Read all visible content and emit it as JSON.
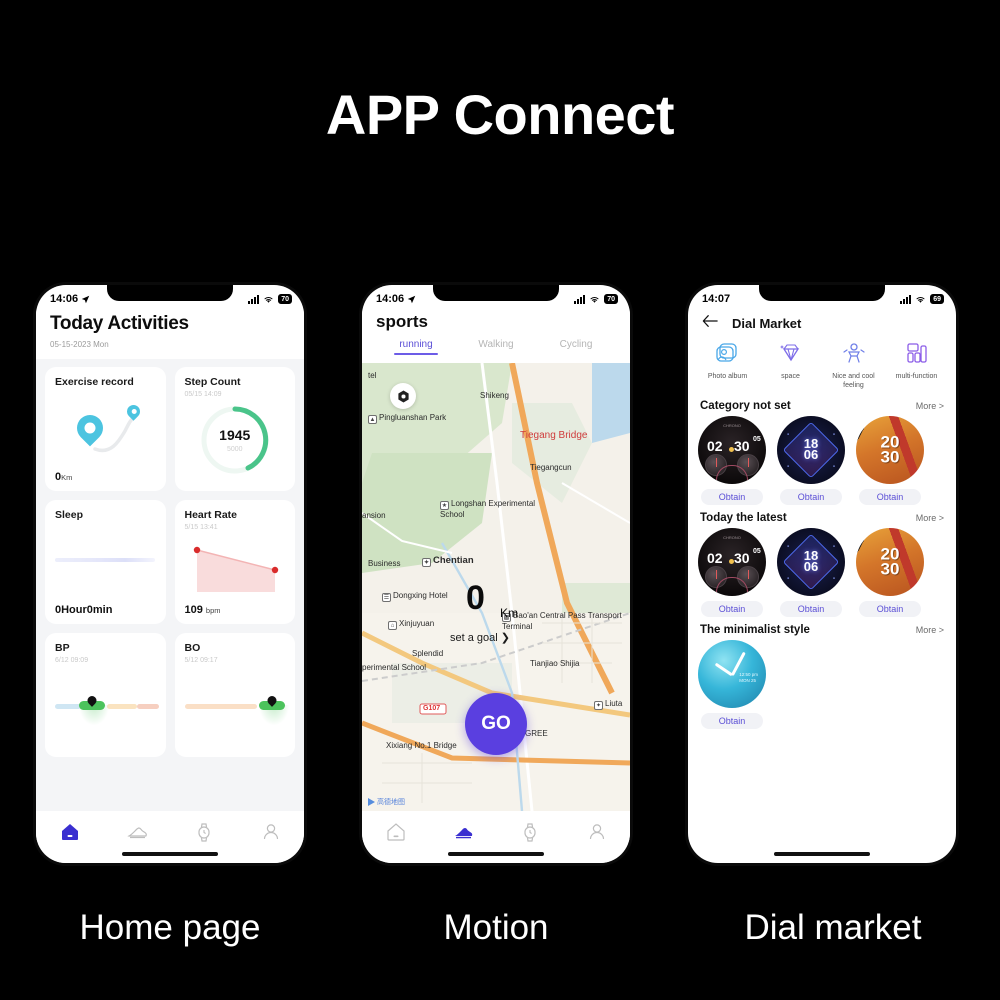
{
  "banner": {
    "title": "APP Connect"
  },
  "captions": {
    "phone1": "Home page",
    "phone2": "Motion",
    "phone3": "Dial market"
  },
  "phone1": {
    "status": {
      "time": "14:06",
      "battery": "70",
      "location_icon": "location-arrow-icon",
      "signal_icon": "signal-bars-icon",
      "wifi_icon": "wifi-icon"
    },
    "header": {
      "title": "Today Activities",
      "date": "05-15-2023 Mon"
    },
    "cards": [
      {
        "title": "Exercise record",
        "subtitle": "",
        "value": "0",
        "unit": "Km",
        "icon": "map-pin-icon"
      },
      {
        "title": "Step Count",
        "subtitle": "05/15 14:09",
        "value": "1945",
        "goal": "5000",
        "progress_pct": 39,
        "icon": "progress-ring-icon"
      },
      {
        "title": "Sleep",
        "subtitle": "",
        "value": "0Hour0min",
        "unit": "",
        "icon": "sleep-bar-icon"
      },
      {
        "title": "Heart Rate",
        "subtitle": "5/15 13:41",
        "value": "109",
        "unit": "bpm",
        "icon": "heart-rate-chart-icon"
      },
      {
        "title": "BP",
        "subtitle": "6/12 09:09",
        "value": "",
        "unit": "",
        "icon": "bp-slider-icon"
      },
      {
        "title": "BO",
        "subtitle": "5/12 09:17",
        "value": "",
        "unit": "",
        "icon": "bo-slider-icon"
      }
    ],
    "tabbar": [
      {
        "name": "home-icon",
        "label": "Home",
        "active": true
      },
      {
        "name": "shoe-icon",
        "label": "Sports",
        "active": false
      },
      {
        "name": "watch-icon",
        "label": "Device",
        "active": false
      },
      {
        "name": "profile-icon",
        "label": "Me",
        "active": false
      }
    ]
  },
  "phone2": {
    "status": {
      "time": "14:06",
      "battery": "70"
    },
    "header": {
      "title": "sports"
    },
    "tabs": [
      {
        "label": "running",
        "active": true
      },
      {
        "label": "Walking",
        "active": false
      },
      {
        "label": "Cycling",
        "active": false
      }
    ],
    "map": {
      "distance_value": "0",
      "distance_unit": "Km",
      "goal_label": "set a goal",
      "go_label": "GO",
      "attribution": "高德地图",
      "labels": [
        "Shikeng",
        "Pingluanshan Park",
        "Tiegang Bridge",
        "Tiegangcun",
        "Longshan Experimental School",
        "ansion",
        "Business",
        "Chentian",
        "Dongxing Hotel",
        "Xinjuyuan",
        "Bao'an Central Pass",
        "Transport Terminal",
        "Splendid",
        "perimental School",
        "Tianjiao Shijia",
        "Liuta",
        "GREE",
        "G107",
        "Xixiang No.1 Bridge",
        "tel"
      ]
    },
    "tabbar": [
      {
        "name": "home-icon",
        "active": false
      },
      {
        "name": "shoe-icon",
        "active": true
      },
      {
        "name": "watch-icon",
        "active": false
      },
      {
        "name": "profile-icon",
        "active": false
      }
    ]
  },
  "phone3": {
    "status": {
      "time": "14:07",
      "battery": "69"
    },
    "nav": {
      "back_icon": "back-arrow-icon",
      "title": "Dial Market"
    },
    "categories": [
      {
        "label": "Photo album",
        "icon": "photo-album-icon"
      },
      {
        "label": "space",
        "icon": "diamond-icon"
      },
      {
        "label": "Nice and cool feeling",
        "icon": "cool-feeling-icon"
      },
      {
        "label": "multi-function",
        "icon": "multi-function-icon"
      }
    ],
    "sections": [
      {
        "title": "Category not set",
        "more": "More >",
        "faces": [
          {
            "style": "chrono",
            "hh": "02",
            "mm": "30",
            "ss": "05",
            "top_text": "CHRONO",
            "button": "Obtain"
          },
          {
            "style": "neon",
            "hh": "18",
            "mm": "06",
            "button": "Obtain"
          },
          {
            "style": "grunge",
            "hh": "20",
            "mm": "30",
            "button": "Obtain"
          }
        ]
      },
      {
        "title": "Today the latest",
        "more": "More >",
        "faces": [
          {
            "style": "chrono",
            "hh": "02",
            "mm": "30",
            "ss": "05",
            "top_text": "CHRONO",
            "button": "Obtain"
          },
          {
            "style": "neon",
            "hh": "18",
            "mm": "06",
            "button": "Obtain"
          },
          {
            "style": "grunge",
            "hh": "20",
            "mm": "30",
            "button": "Obtain"
          }
        ]
      },
      {
        "title": "The minimalist style",
        "more": "More >",
        "faces": [
          {
            "style": "minimal",
            "time_label": "12:50 pm",
            "date_label": "MON 25",
            "button": "Obtain"
          }
        ]
      }
    ]
  },
  "colors": {
    "background": "#000000",
    "accent_purple": "#5b4fd6",
    "go_button": "#5a3fe0",
    "step_green": "#4ac48a",
    "pin_cyan": "#4cc4e0",
    "heart_red": "#d92b2b",
    "knob_green": "#4cc35c"
  }
}
